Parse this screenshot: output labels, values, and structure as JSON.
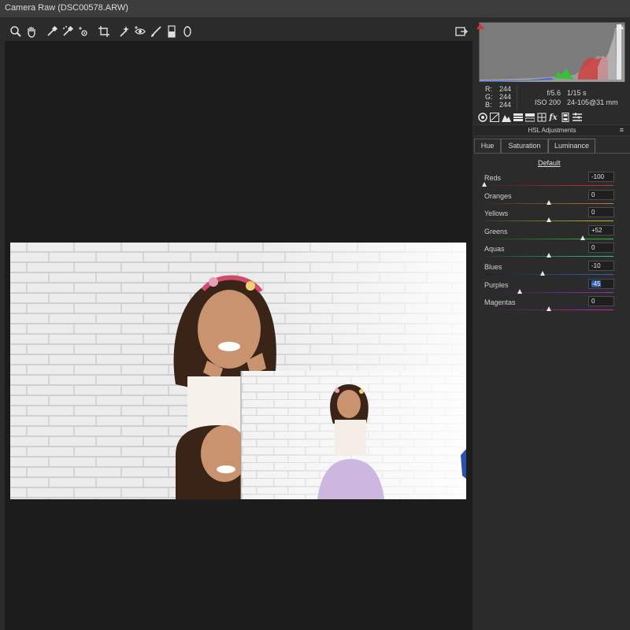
{
  "window": {
    "title": "Camera Raw (DSC00578.ARW)"
  },
  "toolbar": {
    "tools": [
      "zoom-tool",
      "hand-tool",
      "white-balance-tool",
      "color-sampler-tool",
      "targeted-adjustment-tool",
      "crop-tool",
      "spot-removal-tool",
      "red-eye-tool",
      "adjustment-brush-tool",
      "graduated-filter-tool",
      "radial-filter-tool"
    ],
    "open_button_icon": "export-icon"
  },
  "info": {
    "r_label": "R:",
    "r": "244",
    "g_label": "G:",
    "g": "244",
    "b_label": "B:",
    "b": "244",
    "aperture": "f/5.6",
    "shutter": "1/15 s",
    "iso": "ISO 200",
    "lens": "24-105@31 mm"
  },
  "panel": {
    "title": "HSL Adjustments",
    "tabs": [
      "Hue",
      "Saturation",
      "Luminance"
    ],
    "active_tab": "Luminance",
    "default_link": "Default",
    "sliders": [
      {
        "label": "Reds",
        "value": "-100",
        "num": -100,
        "track": [
          "#4a2020",
          "#c73535"
        ]
      },
      {
        "label": "Oranges",
        "value": "0",
        "num": 0,
        "track": [
          "#3a2a1a",
          "#c77a2a"
        ]
      },
      {
        "label": "Yellows",
        "value": "0",
        "num": 0,
        "track": [
          "#3a3a1a",
          "#c7c22a"
        ]
      },
      {
        "label": "Greens",
        "value": "+52",
        "num": 52,
        "track": [
          "#1a3a1a",
          "#35c735"
        ]
      },
      {
        "label": "Aquas",
        "value": "0",
        "num": 0,
        "track": [
          "#1a3a3a",
          "#2ac7a7"
        ]
      },
      {
        "label": "Blues",
        "value": "-10",
        "num": -10,
        "track": [
          "#1a1a3a",
          "#2a6ac7"
        ]
      },
      {
        "label": "Purples",
        "value": "-45",
        "num": -45,
        "track": [
          "#2a1a3a",
          "#a52ac7"
        ]
      },
      {
        "label": "Magentas",
        "value": "0",
        "num": 0,
        "track": [
          "#3a1a3a",
          "#c72ac2"
        ]
      }
    ]
  },
  "colors": {
    "panel_bg": "#2b2b2b",
    "canvas_bg": "#1c1c1c",
    "selection": "#2e5aa8"
  }
}
